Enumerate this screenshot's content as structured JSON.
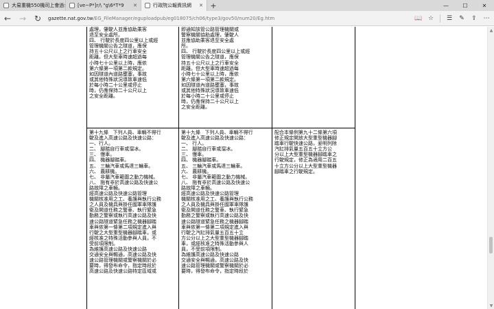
{
  "browser": {
    "tabs": [
      {
        "title": "大易重機550機司上會過公司",
        "active": false
      },
      {
        "title": "[ve~P*]r/\\ \"g\\6*T*9",
        "active": false
      },
      {
        "title": "行政院公報資訊網",
        "active": true
      }
    ],
    "new_tab": "+",
    "url_host": "gazette.nat.gov.tw",
    "url_path": "/EG_FileManager/eguploadpub/eg018075/ch06/type3/gov50/num20/Eg.htm"
  },
  "document": {
    "row1": {
      "col1": "處理，肇駛人並應協助乘客\n退至安全處所。\n四、 行駛於長度四公里以上或經\n管理機關公告之隧道，應保\n持五十公尺以上之行車安全\n距離。但大型車時速超過每\n小時七十公里以上時，應依\n第六條第一項第二款規定。\n如因隧道內道路壅塞，事故\n或其他特殊狀況導致車速低\n於每小時二十公里或停止\n時，仍應保持二十公尺以上\n之安全距離。",
      "col2": "即通知該管公路管理機關或\n警察機關協助處理，肇駛人\n並應協助乘客退至安全處\n所。\n四、 行駛於長度四公里以上或經\n管理機關公告之隧道，應保\n持五十公尺以上之行車安全\n距離。但大型車時速超過每\n小時七十公里以上時，應依\n第六條第一項第二款規定。\n如因隧道內道路壅塞，事故\n或其他特殊狀況導致車速低\n於每小時二十公里或停止\n時，仍應保持二十公尺以上\n之安全距離。"
    },
    "row2": {
      "col1": "第十九條   下列人員、車輛不得行\n駛及進入高速公路及快速公路：\n一、行人。\n二、 腳踏自行車或溜冰。\n三、 慢車。\n四、 機器腳踏車。\n五、 三輪汽車或馬達三輪車。\n六、 農耕機。\n七、 非屬汽車範圍之動力機械。\n八、 拖有非於高速公路及快速公\n路故障之車輛。\n經高速公路及快速公路管理\n機關核准用之工、養護與執行公務\n之人員及機具與掛任國軍車隊護\n衛及開道任務之警車、執行緊急\n勤務之警察或執行高速公路及快\n速公路隧道緊急任務之機器腳踏\n車與依第一條第二項規定進入與\n行駛之大型重型機器腳踏車，或\n經核准之特殊活動參與人員，不\n受前項限制。\n為維護高速公路及快速公路\n交通安全與暢通，高速公路及快\n速公路管理機關或警察機關於必\n要時，得發布命令，指定時段於\n高速公路及快速公路特定區域或",
      "col2": "第十九條   下列人員、車輛不得行\n駛及進入高速公路及快速公路：\n一、 行人。\n二、 腳踏自行車或溜冰。\n三、 慢車。\n四、 機器腳踏車。\n五、 三輪汽車或馬達三輪車。\n六、 農耕機。\n七、 非屬汽車範圍之動力機械。\n八、 拖有非於高速公路及快速公\n路故障之車輛。\n經高速公路及快速公路管理\n機關核准用之工、養護與執行公務\n之人員及機具與掛任國軍車隊護\n衛及開道任務之警車、執行緊急\n勤務之警察或執行高速公路及快\n速公路隧道緊急任務之機器腳踏\n車與依第一條第二項規定進入與\n行駛之汽缸排氣量五百五十立\n方公分以上之大型重型機器腳踏\n車，或經核准之特殊活動參與人\n員，不受前項限制。\n為維護高速公路及快速公路\n交通安全與暢通，高速公路及快\n速公路管理機關或警察機關於必\n要時，得發布命令，指定時段於",
      "col3": "配合本條例第九十二條第六項\n修正規定開放大型重型機器腳\n踏車行駛快速公路，爰明列除\n汽缸排氣量五百五十立方公\n分以上大型重型機器腳踏車之\n行駛規定，修正為適用二百五\n十立方公分以上大型重型機器\n腳踏車之行駛規定。"
    }
  }
}
